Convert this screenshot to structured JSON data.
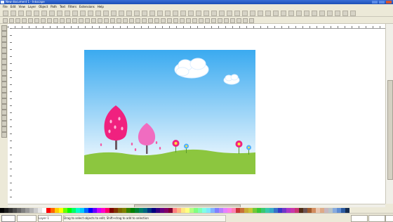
{
  "window": {
    "title": "New document 1 - Inkscape"
  },
  "menu": {
    "items": [
      "File",
      "Edit",
      "View",
      "Layer",
      "Object",
      "Path",
      "Text",
      "Filters",
      "Extensions",
      "Help"
    ]
  },
  "colors": {
    "sky_top": "#3aaaf0",
    "sky_bottom": "#ffffff",
    "grass": "#8cc63f",
    "tree_pink": "#f0217f",
    "tree_light": "#f06cc0",
    "trunk": "#6d5a64"
  },
  "palette": [
    "#000000",
    "#1a1a1a",
    "#333333",
    "#4d4d4d",
    "#666666",
    "#808080",
    "#999999",
    "#b3b3b3",
    "#cccccc",
    "#e6e6e6",
    "#ffffff",
    "#ff0000",
    "#ff6600",
    "#ffcc00",
    "#ffff00",
    "#66ff00",
    "#00ff00",
    "#00ff66",
    "#00ffcc",
    "#00ccff",
    "#0066ff",
    "#0000ff",
    "#6600ff",
    "#cc00ff",
    "#ff00cc",
    "#ff0066",
    "#800000",
    "#803300",
    "#806600",
    "#808000",
    "#338000",
    "#008000",
    "#008033",
    "#008066",
    "#006680",
    "#003380",
    "#000080",
    "#330080",
    "#660080",
    "#800066",
    "#800033",
    "#ff8080",
    "#ffb380",
    "#ffe680",
    "#ffff80",
    "#b3ff80",
    "#80ff80",
    "#80ffb3",
    "#80ffe6",
    "#80e6ff",
    "#80b3ff",
    "#8080ff",
    "#b380ff",
    "#e680ff",
    "#ff80e6",
    "#ff80b3",
    "#c83737",
    "#c87137",
    "#c8ab37",
    "#c8c837",
    "#71c837",
    "#37c837",
    "#37c871",
    "#37c8ab",
    "#37abc8",
    "#3771c8",
    "#3737c8",
    "#7137c8",
    "#ab37c8",
    "#c837ab",
    "#c83771",
    "#502d16",
    "#6c5353",
    "#a05a2c",
    "#d38d5f",
    "#e9c6af",
    "#deaa87",
    "#c8b7be",
    "#b7c4c8",
    "#87aade",
    "#5f8dd3",
    "#2c5aa0",
    "#162d50"
  ],
  "status": {
    "message": "Drag to select objects to edit; Shift+drag to add to selection",
    "layer": "Layer 1",
    "x": "",
    "y": "",
    "zoom": ""
  }
}
